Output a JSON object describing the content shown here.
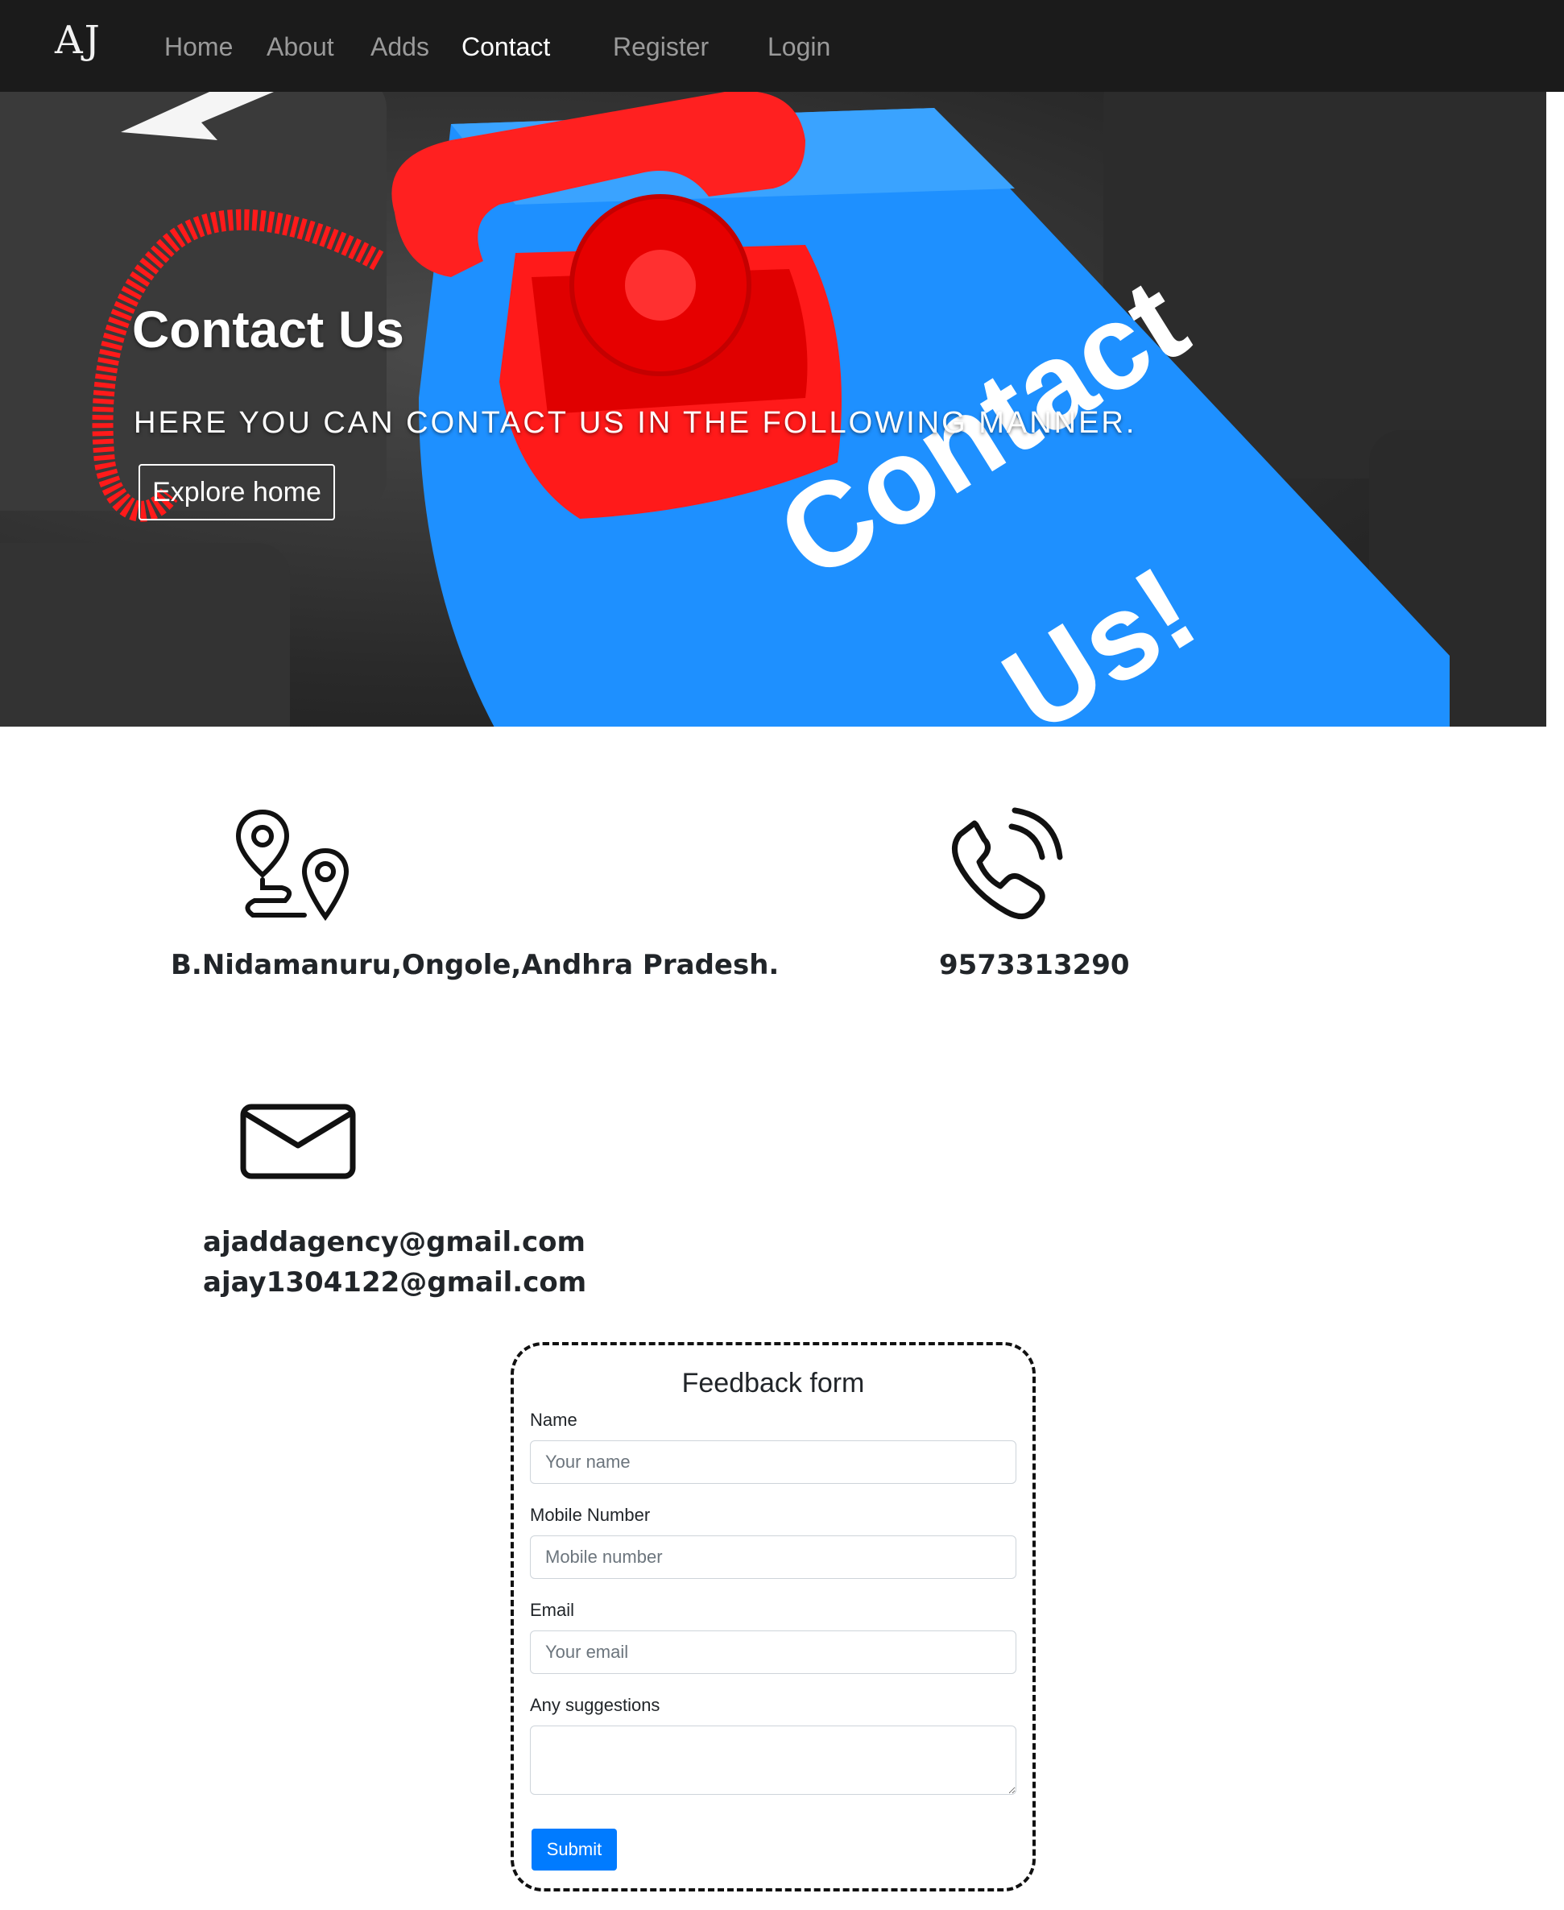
{
  "navbar": {
    "brand": "AJ",
    "links": [
      {
        "label": "Home"
      },
      {
        "label": "About"
      },
      {
        "label": "Adds"
      },
      {
        "label": "Contact"
      },
      {
        "label": "Register"
      },
      {
        "label": "Login"
      }
    ],
    "active": "Contact"
  },
  "hero": {
    "title": "Contact Us",
    "subtitle": "HERE YOU CAN CONTACT US IN THE FOLLOWING MANNER.",
    "button_label": "Explore home",
    "image_text_line1": "Contact",
    "image_text_line2": "Us!"
  },
  "contact": {
    "address": "B.Nidamanuru,Ongole,Andhra Pradesh.",
    "phone": "9573313290",
    "email_1": "ajaddagency@gmail.com",
    "email_2": "ajay1304122@gmail.com",
    "icons": [
      "location-pins-icon",
      "phone-call-icon",
      "envelope-icon"
    ]
  },
  "form": {
    "title": "Feedback form",
    "name_label": "Name",
    "name_placeholder": "Your name",
    "mobile_label": "Mobile Number",
    "mobile_placeholder": "Mobile number",
    "email_label": "Email",
    "email_placeholder": "Your email",
    "suggestions_label": "Any suggestions",
    "submit_label": "Submit"
  },
  "colors": {
    "navbar_bg": "#1b1b1b",
    "primary": "#007bff",
    "hero_key_blue": "#1e90ff",
    "phone_red": "#ff1a1a"
  }
}
